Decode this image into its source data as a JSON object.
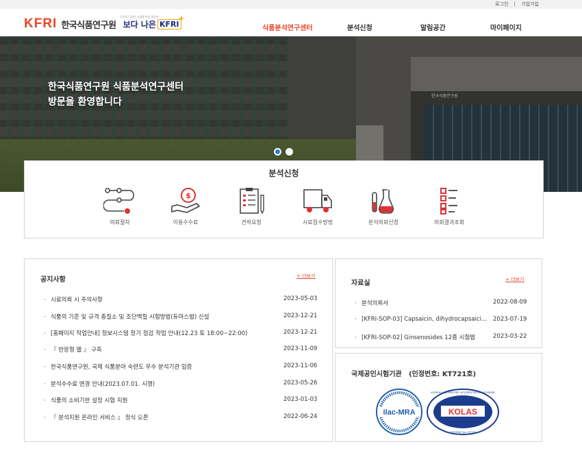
{
  "util_links": {
    "login": "로그인",
    "sep": "|",
    "join": "기업가입"
  },
  "logo": {
    "mark": "KFRI",
    "name": "한국식품연구원",
    "tagline": "국민의 건강한 식생활 보장 동반자",
    "slogan_a": "보다 나은",
    "slogan_b": "KFRI"
  },
  "nav": [
    {
      "label": "식품분석연구센터",
      "active": true
    },
    {
      "label": "분석신청",
      "active": false
    },
    {
      "label": "알림공간",
      "active": false
    },
    {
      "label": "마이페이지",
      "active": false
    }
  ],
  "hero": {
    "line1": "한국식품연구원 식품분석연구센터",
    "line2": "방문을 환영합니다",
    "building_sign": "한국식품연구원"
  },
  "services": {
    "title": "분석신청",
    "items": [
      {
        "label": "의뢰절차",
        "icon": "process-flow-icon"
      },
      {
        "label": "이용수수료",
        "icon": "fee-hand-coin-icon"
      },
      {
        "label": "견적요청",
        "icon": "quote-checklist-icon"
      },
      {
        "label": "시료접수방법",
        "icon": "delivery-truck-icon"
      },
      {
        "label": "분석의뢰신청",
        "icon": "lab-flask-icon"
      },
      {
        "label": "의뢰결과조회",
        "icon": "result-list-icon"
      }
    ]
  },
  "notice": {
    "title": "공지사항",
    "more": "+ 더보기",
    "rows": [
      {
        "bullet": "·",
        "text": "시료의뢰 시 주의사항",
        "date": "2023-05-03"
      },
      {
        "bullet": "·",
        "text": "식품의 기준 및 규격 총질소 및 조단백질 시험방법(듀마스법) 신설",
        "date": "2023-12-21"
      },
      {
        "bullet": "·",
        "text": "[홈페이지 작업안내] 정보시스템 정기 점검 작업 안내(12.23 토 18:00~22:00)",
        "date": "2023-12-21"
      },
      {
        "bullet": "·",
        "text": "『 반응형 웹 』 구축",
        "date": "2023-11-09"
      },
      {
        "bullet": "·",
        "text": "한국식품연구원, 국제 식품분야 숙련도 우수 분석기관 입증",
        "date": "2023-11-06"
      },
      {
        "bullet": "·",
        "text": "분석수수료 변경 안내(2023.07.01. 시행)",
        "date": "2023-05-26"
      },
      {
        "bullet": "·",
        "text": "식품의 소비기한 설정 시험 지원",
        "date": "2023-01-03"
      },
      {
        "bullet": "·",
        "text": "『 분석지원 온라인 서비스 』 정식 오픈",
        "date": "2022-06-24"
      }
    ]
  },
  "archive": {
    "title": "자료실",
    "more": "+ 더보기",
    "rows": [
      {
        "bullet": "·",
        "text": "분석의뢰서",
        "date": "2022-08-09"
      },
      {
        "bullet": "·",
        "text": "[KFRI-SOP-03] Capsaicin, dihydrocapsaici...",
        "date": "2023-07-19"
      },
      {
        "bullet": "·",
        "text": "[KFRI-SOP-02] Ginsenosides 12종 시험법",
        "date": "2023-03-22"
      }
    ]
  },
  "accreditation": {
    "title": "국제공인시험기관",
    "number": "(인정번호: KT721호)",
    "ilac_text": "ilac-MRA",
    "kolas_text": "KOLAS",
    "kolas_ring": "KOREA LABORATORY ACCREDITATION SCHEME",
    "kolas_no": "TESTING No. KT721"
  },
  "colors": {
    "accent": "#e8462c",
    "navy": "#1c2e7a",
    "active_dot": "#2a7dd4"
  }
}
